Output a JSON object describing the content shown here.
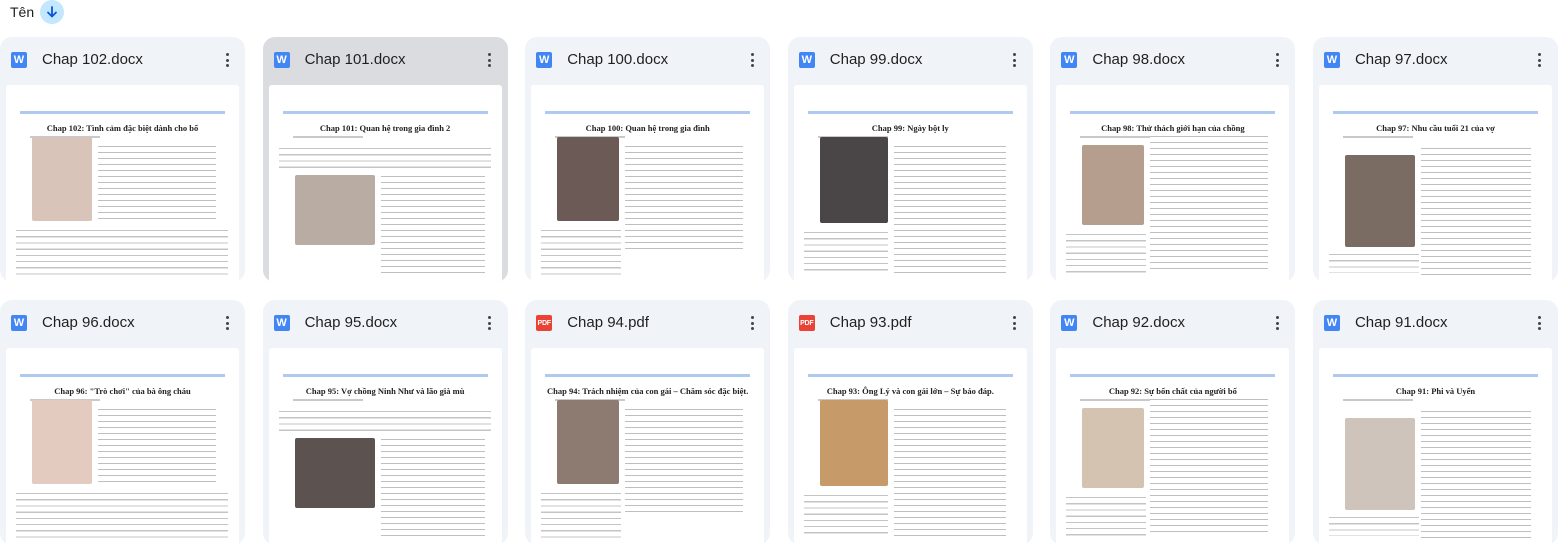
{
  "sort": {
    "label": "Tên",
    "direction_icon": "arrow-down-icon"
  },
  "files": [
    {
      "name": "Chap 102.docx",
      "type": "docx",
      "icon_letter": "W",
      "preview_title": "Chap 102: Tình cảm đặc biệt dành cho bố",
      "selected": false,
      "photo_color": "#d8c4b8"
    },
    {
      "name": "Chap 101.docx",
      "type": "docx",
      "icon_letter": "W",
      "preview_title": "Chap 101: Quan hệ trong gia đình 2",
      "selected": true,
      "photo_color": "#b9ada3"
    },
    {
      "name": "Chap 100.docx",
      "type": "docx",
      "icon_letter": "W",
      "preview_title": "Chap 100: Quan hệ trong gia đình",
      "selected": false,
      "photo_color": "#6b5a55"
    },
    {
      "name": "Chap 99.docx",
      "type": "docx",
      "icon_letter": "W",
      "preview_title": "Chap 99: Ngày bột ly",
      "selected": false,
      "photo_color": "#4a4648"
    },
    {
      "name": "Chap 98.docx",
      "type": "docx",
      "icon_letter": "W",
      "preview_title": "Chap 98: Thử thách giới hạn của chồng",
      "selected": false,
      "photo_color": "#b59e8e"
    },
    {
      "name": "Chap 97.docx",
      "type": "docx",
      "icon_letter": "W",
      "preview_title": "Chap 97: Nhu cầu tuổi 21 của vợ",
      "selected": false,
      "photo_color": "#7a6b63"
    },
    {
      "name": "Chap 96.docx",
      "type": "docx",
      "icon_letter": "W",
      "preview_title": "Chap 96: \"Trò chơi\" của bà ông cháu",
      "selected": false,
      "photo_color": "#e3cbc0"
    },
    {
      "name": "Chap 95.docx",
      "type": "docx",
      "icon_letter": "W",
      "preview_title": "Chap 95: Vợ chồng Ninh Như và lão già mù",
      "selected": false,
      "photo_color": "#5c5350"
    },
    {
      "name": "Chap 94.pdf",
      "type": "pdf",
      "icon_letter": "PDF",
      "preview_title": "Chap 94: Trách nhiệm của con gái – Chăm sóc đặc biệt.",
      "selected": false,
      "photo_color": "#8d7a70"
    },
    {
      "name": "Chap 93.pdf",
      "type": "pdf",
      "icon_letter": "PDF",
      "preview_title": "Chap 93: Ông Lý và con gái lớn – Sự báo đáp.",
      "selected": false,
      "photo_color": "#c79a6a"
    },
    {
      "name": "Chap 92.docx",
      "type": "docx",
      "icon_letter": "W",
      "preview_title": "Chap 92: Sự bốn chất của người bố",
      "selected": false,
      "photo_color": "#d4c3b1"
    },
    {
      "name": "Chap 91.docx",
      "type": "docx",
      "icon_letter": "W",
      "preview_title": "Chap 91: Phi và Uyển",
      "selected": false,
      "photo_color": "#cfc4bb"
    }
  ]
}
